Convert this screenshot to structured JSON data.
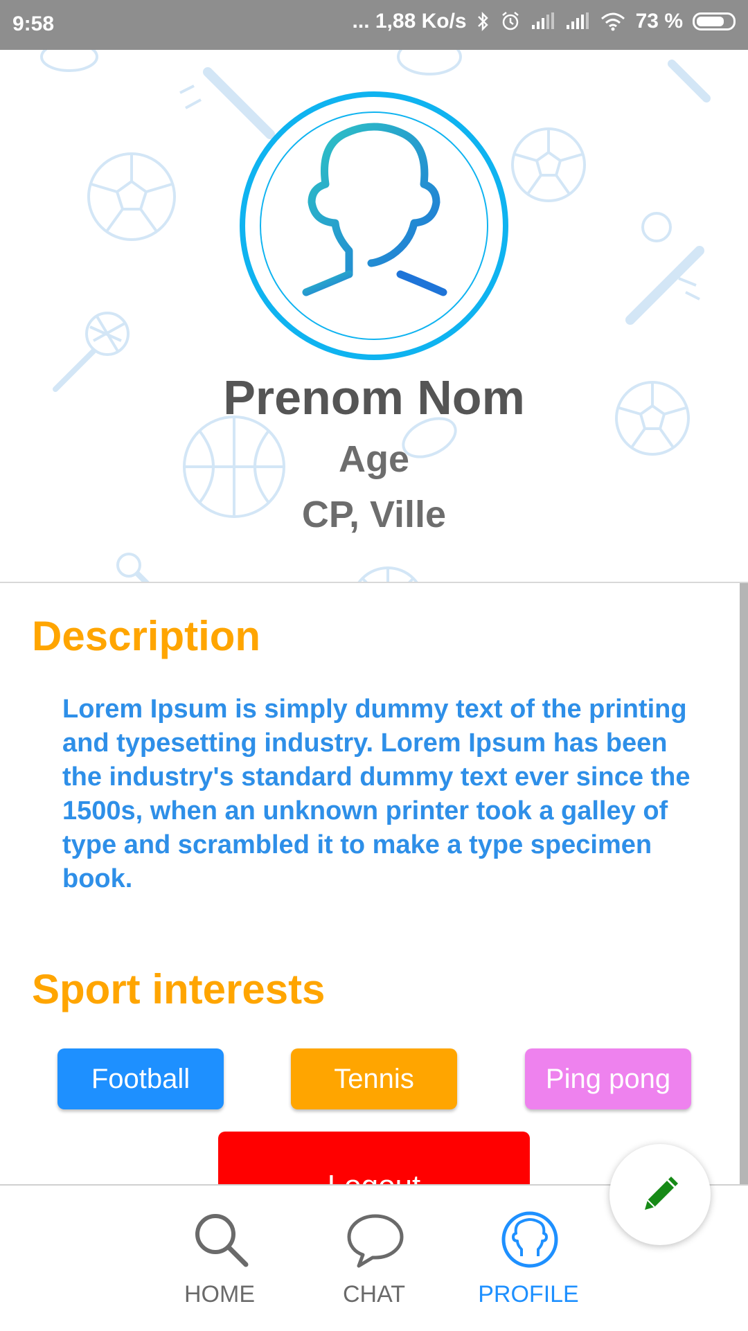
{
  "status_bar": {
    "time": "9:58",
    "network_speed": "... 1,88 Ko/s",
    "battery_percent": "73 %"
  },
  "profile": {
    "name": "Prenom Nom",
    "age": "Age",
    "location": "CP, Ville"
  },
  "description": {
    "title": "Description",
    "text": "Lorem Ipsum is simply dummy text of the printing and typesetting industry. Lorem Ipsum has been the industry's standard dummy text ever since the 1500s, when an unknown printer took a galley of type and scrambled it to make a type specimen book."
  },
  "interests": {
    "title": "Sport interests",
    "chips": [
      {
        "label": "Football",
        "color": "#1e90ff"
      },
      {
        "label": "Tennis",
        "color": "#ffa500"
      },
      {
        "label": "Ping pong",
        "color": "#ee82ee"
      }
    ]
  },
  "logout": {
    "label": "Logout",
    "color": "#ff0000"
  },
  "nav": {
    "items": [
      {
        "label": "HOME",
        "icon": "search-icon",
        "active": false
      },
      {
        "label": "CHAT",
        "icon": "chat-icon",
        "active": false
      },
      {
        "label": "PROFILE",
        "icon": "profile-icon",
        "active": true
      }
    ]
  },
  "fab": {
    "icon": "pencil-icon"
  },
  "colors": {
    "accent": "#1e90ff",
    "section_title": "#ffa500",
    "description_text": "#2e8fe8",
    "status_bar": "#8e8e8e"
  }
}
